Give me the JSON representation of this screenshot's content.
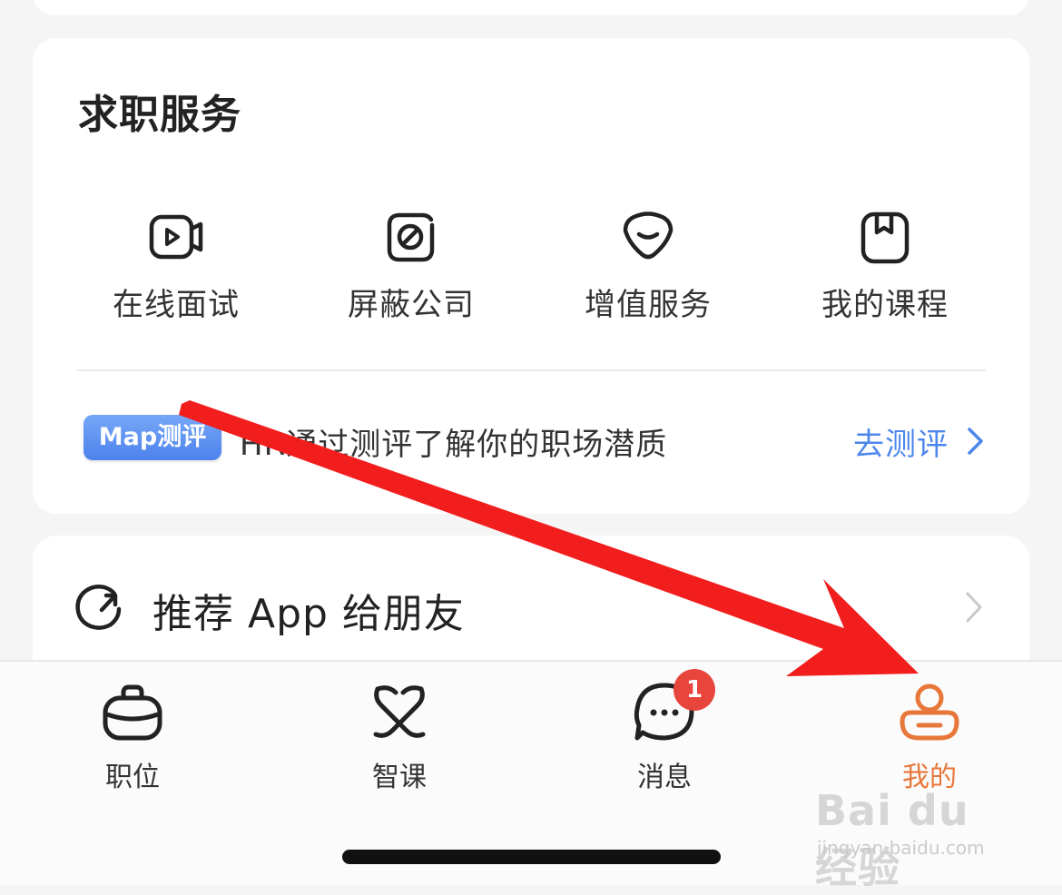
{
  "service_section": {
    "title": "求职服务",
    "items": [
      {
        "label": "在线面试",
        "icon": "video-interview-icon"
      },
      {
        "label": "屏蔽公司",
        "icon": "block-company-icon"
      },
      {
        "label": "增值服务",
        "icon": "value-added-service-icon"
      },
      {
        "label": "我的课程",
        "icon": "my-courses-icon"
      }
    ],
    "map": {
      "badge": "Map测评",
      "text": "HR通过测评了解你的职场潜质",
      "action": "去测评"
    }
  },
  "share": {
    "label": "推荐 App 给朋友",
    "icon": "share-refresh-icon"
  },
  "tabbar": {
    "tabs": [
      {
        "label": "职位",
        "icon": "briefcase-icon",
        "active": false
      },
      {
        "label": "智课",
        "icon": "course-knot-icon",
        "active": false
      },
      {
        "label": "消息",
        "icon": "chat-bubble-icon",
        "active": false,
        "badge": "1"
      },
      {
        "label": "我的",
        "icon": "profile-icon",
        "active": true
      }
    ]
  },
  "watermark": {
    "logo": "Bai du 经验",
    "url": "jingyan.baidu.com"
  },
  "colors": {
    "accent_active": "#e8773a",
    "link_blue": "#4d86ec",
    "badge_red": "#e8453c",
    "annotation_arrow": "#f21d1d"
  }
}
